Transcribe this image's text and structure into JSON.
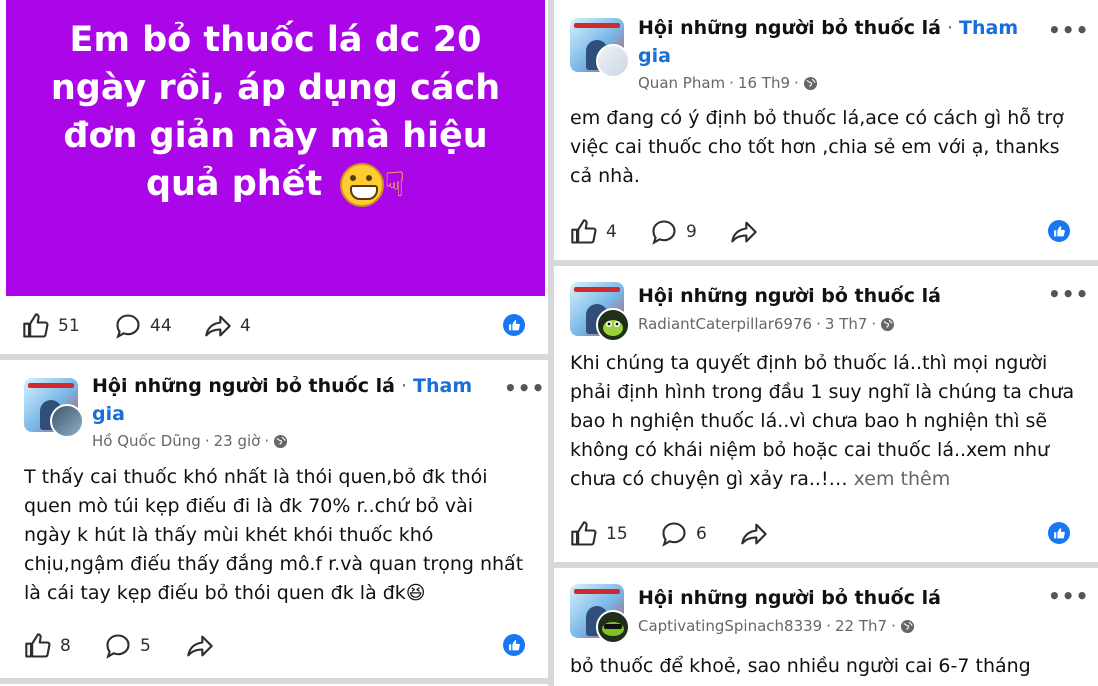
{
  "colors": {
    "hero_bg": "#ab06e8",
    "join_blue": "#1a6ed8",
    "like_blue": "#1877f2",
    "meta_gray": "#65676b"
  },
  "icons": [
    "thumbs-up-icon",
    "comment-icon",
    "share-icon",
    "like-reaction-icon",
    "globe-icon",
    "more-icon"
  ],
  "hero_post": {
    "text": "Em bỏ thuốc lá dc 20 ngày rồi, áp dụng cách đơn giản này mà hiệu quả phết",
    "likes": "51",
    "comments": "44",
    "shares": "4"
  },
  "post_left": {
    "group": "Hội những người bỏ thuốc lá",
    "dot": " · ",
    "join": "Tham gia",
    "author": "Hồ Quốc Dũng",
    "time": "23 giờ",
    "sep": " · ",
    "text": "T thấy cai thuốc khó nhất là thói quen,bỏ đk thói quen mò túi kẹp điếu đi là đk 70% r..chứ bỏ vài ngày k hút là thấy mùi khét khói thuốc khó chịu,ngậm điếu thấy đắng mô.f r.và quan trọng nhất là cái tay kẹp điếu bỏ thói quen đk là đk😆",
    "likes": "8",
    "comments": "5"
  },
  "post_r1": {
    "group": "Hội những người bỏ thuốc lá",
    "dot": " · ",
    "join": "Tham gia",
    "author": "Quan Pham",
    "time": "16 Th9",
    "sep": " · ",
    "text": "em đang có ý định bỏ thuốc lá,ace có cách gì hỗ trợ việc cai thuốc cho tốt hơn ,chia sẻ em với ạ, thanks cả nhà.",
    "likes": "4",
    "comments": "9"
  },
  "post_r2": {
    "group": "Hội những người bỏ thuốc lá",
    "author": "RadiantCaterpillar6976",
    "time": "3 Th7",
    "sep": " · ",
    "text": "Khi chúng ta quyết định bỏ thuốc lá..thì mọi người phải định hình trong đầu 1 suy nghĩ là chúng ta chưa bao h nghiện thuốc lá..vì chưa bao h nghiện thì sẽ không có khái niệm bỏ hoặc cai thuốc lá..xem như chưa có chuyện gì xảy ra..!…",
    "see_more": " xem thêm",
    "likes": "15",
    "comments": "6"
  },
  "post_r3": {
    "group": "Hội những người bỏ thuốc lá",
    "author": "CaptivatingSpinach8339",
    "time": "22 Th7",
    "sep": " · ",
    "text": "bỏ thuốc để khoẻ, sao nhiều người cai 6-7 tháng"
  },
  "more_label": "•••"
}
